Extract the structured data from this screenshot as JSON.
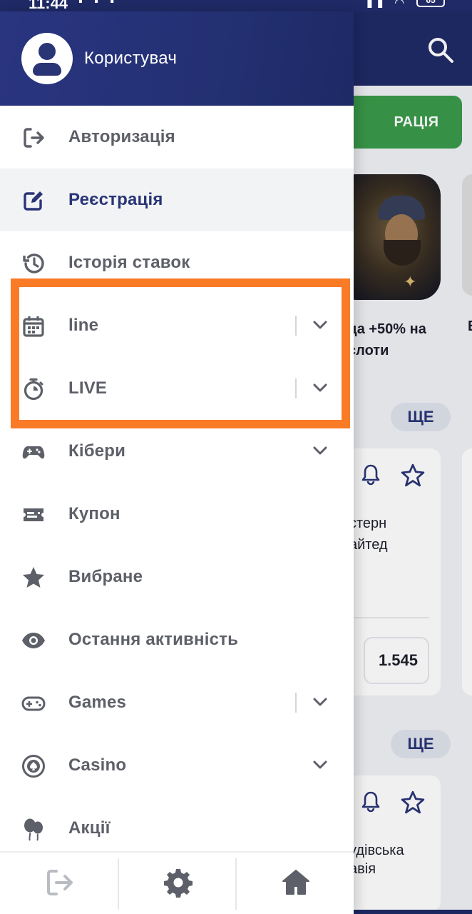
{
  "status_bar": {
    "time": "11:44",
    "battery": "65"
  },
  "background": {
    "register_button": "РАЦІЯ",
    "promo_text": "да +50% на слоти",
    "promo_text_2": "Е",
    "more_label_1": "ЩЕ",
    "more_label_2": "ЩЕ",
    "card1_text": "стерн\nайтед",
    "card1_odd": "1.545",
    "card2_text": "удівська\nавія"
  },
  "drawer": {
    "user_name": "Користувач",
    "menu": [
      {
        "label": "Авторизація",
        "icon": "login-icon",
        "active": false,
        "expandable": false
      },
      {
        "label": "Реєстрація",
        "icon": "edit-icon",
        "active": true,
        "expandable": false
      },
      {
        "label": "Історія ставок",
        "icon": "history-icon",
        "active": false,
        "expandable": false
      },
      {
        "label": "line",
        "icon": "calendar-icon",
        "active": false,
        "expandable": true
      },
      {
        "label": "LIVE",
        "icon": "stopwatch-icon",
        "active": false,
        "expandable": true
      },
      {
        "label": "Кібери",
        "icon": "gamepad-icon",
        "active": false,
        "expandable": true
      },
      {
        "label": "Купон",
        "icon": "ticket-icon",
        "active": false,
        "expandable": false
      },
      {
        "label": "Вибране",
        "icon": "star-icon",
        "active": false,
        "expandable": false
      },
      {
        "label": "Остання активність",
        "icon": "eye-icon",
        "active": false,
        "expandable": false
      },
      {
        "label": "Games",
        "icon": "controller-icon",
        "active": false,
        "expandable": true
      },
      {
        "label": "Casino",
        "icon": "casino-chip-icon",
        "active": false,
        "expandable": true
      },
      {
        "label": "Акції",
        "icon": "balloons-icon",
        "active": false,
        "expandable": false
      }
    ],
    "footer": [
      "logout-icon",
      "settings-icon",
      "home-icon"
    ]
  },
  "colors": {
    "brand": "#2a3576",
    "highlight": "#f97b26",
    "register_green": "#3a9a4a"
  }
}
